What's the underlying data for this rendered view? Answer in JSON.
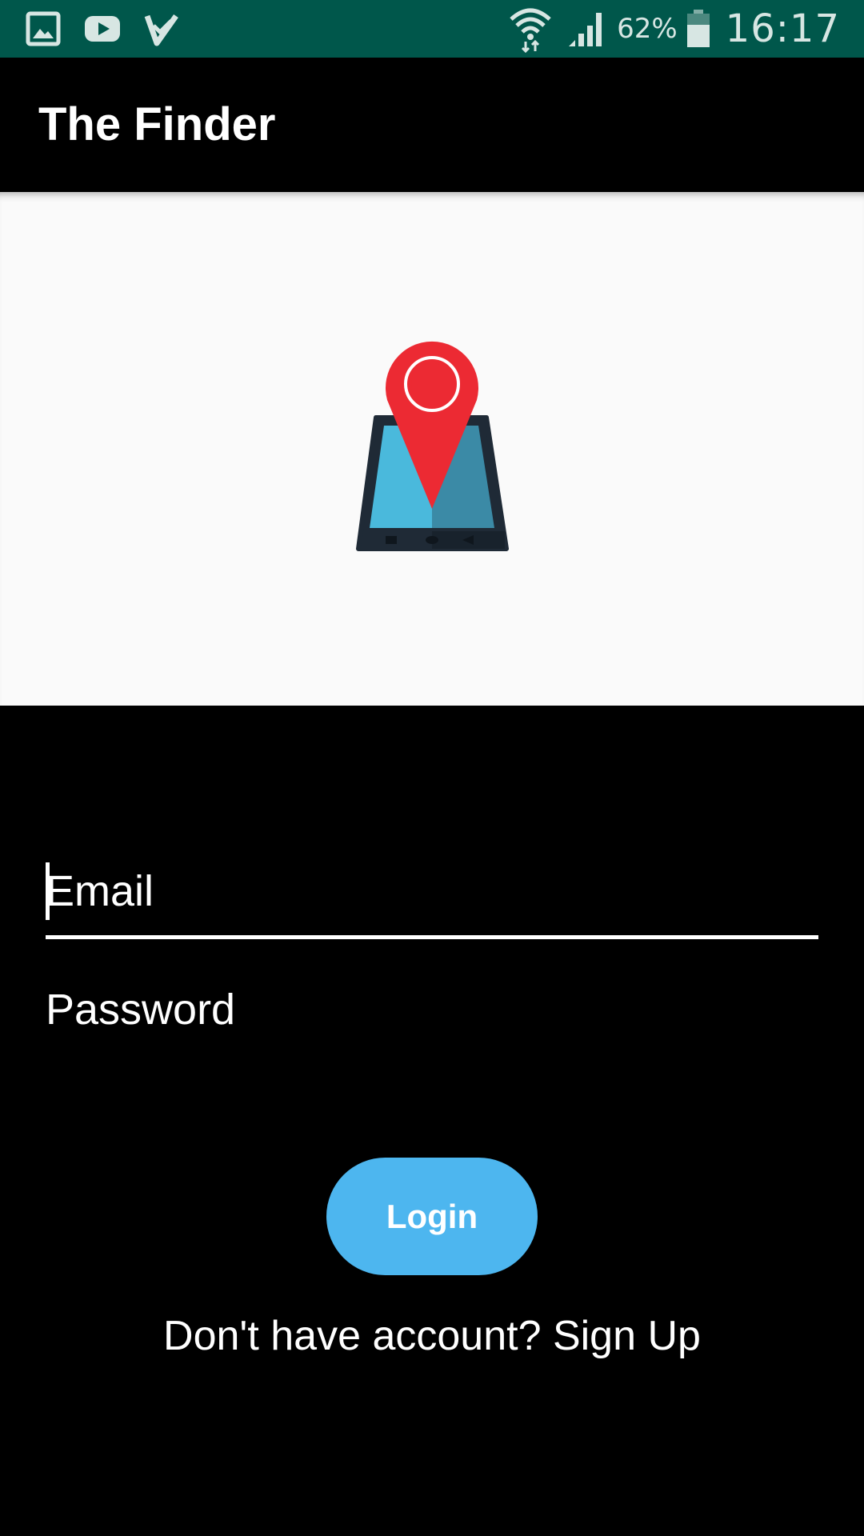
{
  "status_bar": {
    "battery_percent": "62%",
    "time": "16:17",
    "left_icons": [
      "gallery-icon",
      "youtube-icon",
      "checkmark-icon"
    ],
    "right_icons": [
      "wifi-icon",
      "signal-icon",
      "battery-icon"
    ]
  },
  "app_bar": {
    "title": "The Finder"
  },
  "logo": {
    "icon": "location-phone-logo",
    "colors": {
      "pin": "#ec2a33",
      "screen_light": "#4ab9dc",
      "screen_dark": "#3b8aa6",
      "body": "#1f2a36"
    }
  },
  "form": {
    "email_placeholder": "Email",
    "password_placeholder": "Password",
    "login_label": "Login",
    "signup_text": "Don't have account? Sign Up"
  },
  "colors": {
    "status_bar": "#00574b",
    "app_bar": "#000000",
    "background": "#000000",
    "logo_panel": "#fafafa",
    "login_button": "#4db6ef"
  }
}
